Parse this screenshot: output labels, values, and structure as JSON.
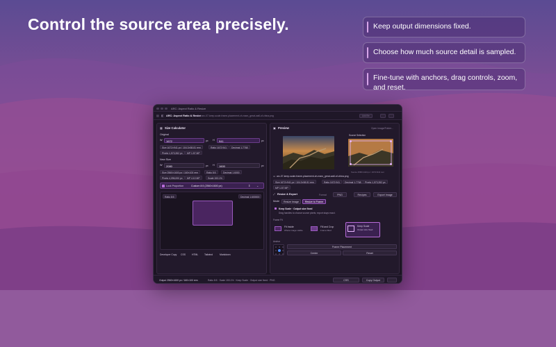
{
  "hero": {
    "title": "Control the source area precisely."
  },
  "callouts": [
    {
      "text": "Keep output dimensions fixed."
    },
    {
      "text": "Choose how much source detail is sampled."
    },
    {
      "text": "Fine-tune with anchors, drag controls, zoom, and reset."
    }
  ],
  "window": {
    "title": "ARC: Aspect Ratio & Resize",
    "app_name": "ARC: Aspect Ratio & Resize",
    "loaded_file": "Loaded arc-07-keep-scale-frame-placement-ch-mars_great-wall-of-china.png",
    "toolbar_right": [
      "Add file",
      "",
      ""
    ]
  },
  "left": {
    "section_title": "Size Calculator",
    "original_label": "Original",
    "orig_w_label": "W",
    "orig_w": "1672",
    "orig_h_label": "H",
    "orig_h": "941",
    "unit": "px",
    "orig_chips": [
      "Size 1672×941 px / 104.3×58.81 rem",
      "Ratio 1672:941",
      "Decimal 1.7768",
      "Pixels 1,573,352 px",
      "MP 1.57 MP"
    ],
    "new_label": "New Size",
    "new_w": "2080",
    "new_h": "1600",
    "new_chips": [
      "Size 2560×1600 px / 160×100 rem",
      "Ratio 8:5",
      "Decimal 1.6000",
      "Pixels 4,096,000 px",
      "MP 4.10 MP",
      "Scale 153.1%"
    ],
    "lock_label": "Lock Proportion",
    "custom_ratio": "Custom 8:5 (2560×1600 px)",
    "ratio_tag": "Ratio 8:5",
    "decimal_tag": "Decimal 1.600000",
    "dev_copy_label": "Developer Copy",
    "dev_copy_items": [
      "CSS",
      "HTML",
      "Tailwind",
      "Markdown"
    ]
  },
  "right": {
    "section_title": "Preview",
    "open_button": "Open Image/Folder...",
    "source_selection": "Source Selection",
    "file_name": "arc-07-keep-scale-frame-placement-ch-mars_great-wall-of-china.png",
    "source_meta": "Source 2568×1444 px / 1672×941 rem",
    "chips": [
      "Size 1672×941 px / 104.3×58.81 rem",
      "Ratio 1672:941",
      "Decimal 1.7768",
      "Pixels 1,573,352 px",
      "MP 1.57 MP"
    ],
    "resize_title": "Resize & Export",
    "format_label": "Format",
    "format_value": "PNG",
    "recipes_button": "Recipes",
    "export_button": "Export Image",
    "mode_label": "Mode",
    "mode_tabs": [
      "Resize Image",
      "Resize to Frame"
    ],
    "keep_scale_title": "Keep Scale · Output size fixed",
    "keep_scale_desc": "Drag handles to choose source pixels; export stays exact.",
    "frame_fit_label": "Frame Fit",
    "frame_fit_options": [
      {
        "title": "Fit Inside",
        "sub": "Whole image visible"
      },
      {
        "title": "Fill and Crop",
        "sub": "Frame filled"
      },
      {
        "title": "Keep Scale",
        "sub": "Output size fixed"
      }
    ],
    "anchor_label": "Anchor",
    "frame_placement": "Frame Placement",
    "center_button": "Center",
    "reset_button": "Reset"
  },
  "status": {
    "output": "Output 2560×1600 px / 160×100 rem",
    "details": "Ratio 8:5 · Scale 153.1% · Keep Scale · Output size fixed · PNG",
    "css_value": "CSS",
    "copy_output": "Copy Output"
  },
  "colors": {
    "accent": "#b86cd9",
    "field_bg": "#3a2150",
    "window_bg": "#1b1422"
  }
}
